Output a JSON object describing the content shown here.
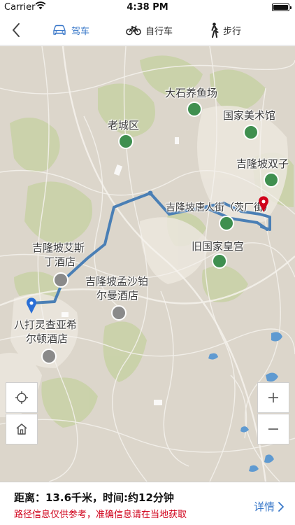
{
  "status_bar": {
    "carrier": "Carrier",
    "time": "4:38 PM"
  },
  "nav": {
    "tabs": [
      {
        "label": "驾车",
        "icon": "car-icon",
        "active": true
      },
      {
        "label": "自行车",
        "icon": "bicycle-icon",
        "active": false
      },
      {
        "label": "步行",
        "icon": "walking-icon",
        "active": false
      }
    ]
  },
  "map": {
    "labels": {
      "dashi": "大石养鱼场",
      "national_art": "国家美术馆",
      "old_town": "老城区",
      "twin_tower": "吉隆坡双子",
      "chinatown": "吉隆坡唐人街（茨厂街）",
      "old_palace": "旧国家皇宫",
      "aston": "吉隆坡艾斯丁酒店",
      "aston_l1": "吉隆坡艾斯",
      "aston_l2": "丁酒店",
      "mensa": "吉隆坡孟沙铂尔曼酒店",
      "mensa_l1": "吉隆坡孟沙铂",
      "mensa_l2": "尔曼酒店",
      "hilton": "八打灵查亚希尔顿酒店",
      "hilton_l1": "八打灵查亚希",
      "hilton_l2": "尔顿酒店"
    },
    "route_color": "#4a7fb5",
    "start_marker_color": "#2a6fd6",
    "end_marker_color": "#d0021b"
  },
  "info": {
    "summary": "距离：13.6千米，时间:约12分钟",
    "disclaimer": "路径信息仅供参考，准确信息请在当地获取",
    "details_label": "详情"
  }
}
